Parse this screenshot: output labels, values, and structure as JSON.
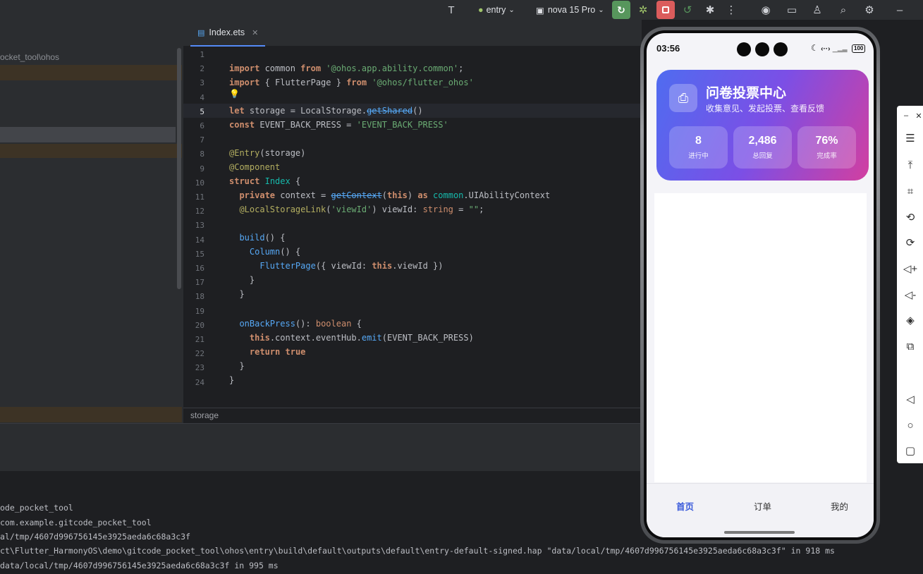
{
  "toolbar": {
    "module": "entry",
    "device": "nova 15 Pro",
    "icons": [
      "text-tool-icon",
      "run-icon",
      "debug-icon",
      "stop-icon",
      "apply-changes-icon",
      "profiler-icon",
      "more-icon",
      "locate-icon",
      "folder-icon",
      "account-icon",
      "search-icon",
      "settings-icon",
      "minimize-icon"
    ]
  },
  "project": {
    "path": "ocket_tool\\ohos"
  },
  "editor": {
    "tab_label": "Index.ets",
    "breadcrumb": "storage",
    "line_numbers": [
      "1",
      "2",
      "3",
      "4",
      "5",
      "6",
      "7",
      "8",
      "9",
      "10",
      "11",
      "12",
      "13",
      "14",
      "15",
      "16",
      "17",
      "18",
      "19",
      "20",
      "21",
      "22",
      "23",
      "24"
    ]
  },
  "console": {
    "lines": [
      "ode_pocket_tool",
      "com.example.gitcode_pocket_tool",
      "al/tmp/4607d996756145e3925aeda6c68a3c3f",
      "ct\\Flutter_HarmonyOS\\demo\\gitcode_pocket_tool\\ohos\\entry\\build\\default\\outputs\\default\\entry-default-signed.hap \"data/local/tmp/4607d996756145e3925aeda6c68a3c3f\" in 918 ms",
      "data/local/tmp/4607d996756145e3925aeda6c68a3c3f in 995 ms"
    ]
  },
  "phone": {
    "time": "03:56",
    "battery": "100",
    "hero": {
      "title": "问卷投票中心",
      "subtitle": "收集意见、发起投票、查看反馈",
      "stats": [
        {
          "value": "8",
          "label": "进行中"
        },
        {
          "value": "2,486",
          "label": "总回复"
        },
        {
          "value": "76%",
          "label": "完成率"
        }
      ]
    },
    "nav": [
      {
        "label": "首页",
        "active": true
      },
      {
        "label": "订单",
        "active": false
      },
      {
        "label": "我的",
        "active": false
      }
    ]
  },
  "side_tools": {
    "icons": [
      "minimize-icon",
      "close-icon",
      "menu-icon",
      "pin-top-icon",
      "crop-icon",
      "rotate-left-icon",
      "rotate-right-icon",
      "volume-up-icon",
      "volume-down-icon",
      "shake-icon",
      "fold-icon",
      "back-nav-icon",
      "home-nav-icon",
      "recents-nav-icon"
    ]
  }
}
